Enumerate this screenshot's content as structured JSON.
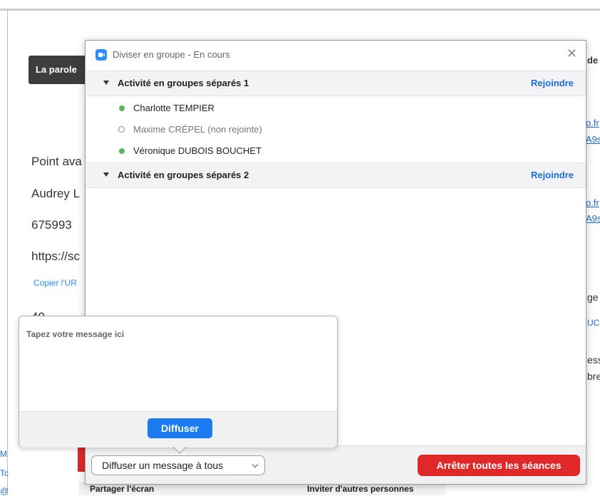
{
  "background": {
    "tooltip": "La parole",
    "lines": [
      "Point ava",
      "Audrey L",
      "675993",
      "https://sc",
      "40"
    ],
    "copy_link": "Copier l'UR",
    "right_fragments": [
      "de d",
      "o.fr",
      "A9s",
      "o.fr",
      "A9s",
      "ge",
      "UCH",
      "ess",
      "bre"
    ],
    "left_tiny": [
      "M",
      "Tc",
      "@"
    ],
    "bottom_bar": {
      "share": "Partager l'écran",
      "invite": "Inviter d'autres personnes"
    }
  },
  "dialog": {
    "title": "Diviser en groupe - En cours",
    "close_icon": "close-icon",
    "groups": [
      {
        "name": "Activité en groupes séparés 1",
        "join": "Rejoindre",
        "members": [
          {
            "name": "Charlotte TEMPIER",
            "status": "joined"
          },
          {
            "name": "Maxime CRÉPEL (non rejointe)",
            "status": "not-joined"
          },
          {
            "name": "Véronique DUBOIS BOUCHET",
            "status": "joined"
          }
        ]
      },
      {
        "name": "Activité en groupes séparés 2",
        "join": "Rejoindre",
        "members": []
      }
    ],
    "footer": {
      "broadcast_label": "Diffuser un message à tous",
      "stop_label": "Arrêter toutes les séances"
    }
  },
  "popover": {
    "placeholder": "Tapez votre message ici",
    "button": "Diffuser"
  },
  "colors": {
    "accent": "#1a7cf0",
    "danger": "#e02828",
    "joined_dot": "#5ab55f"
  }
}
